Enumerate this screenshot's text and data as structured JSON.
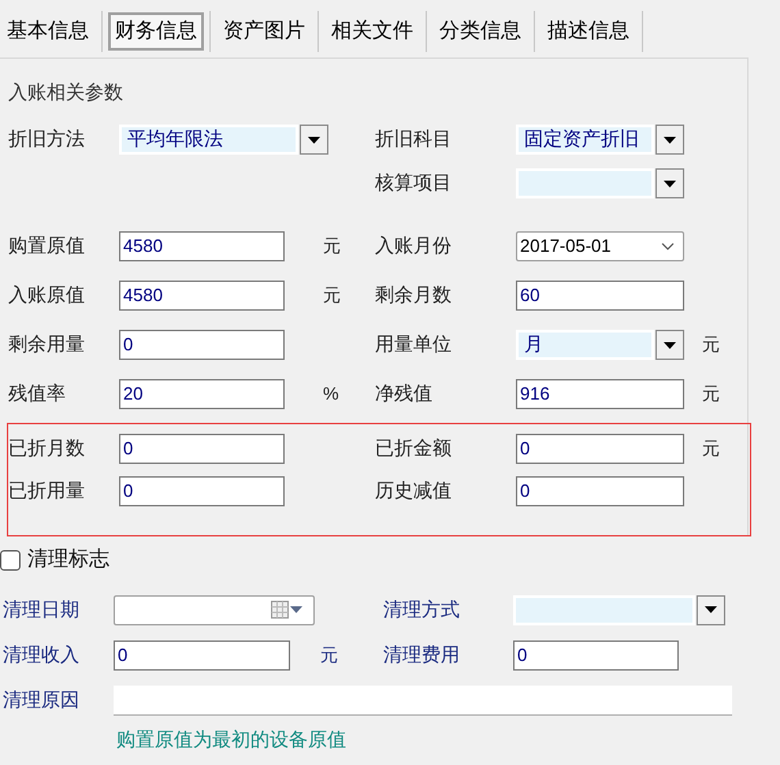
{
  "tabs": [
    {
      "label": "基本信息",
      "selected": false
    },
    {
      "label": "财务信息",
      "selected": true
    },
    {
      "label": "资产图片",
      "selected": false
    },
    {
      "label": "相关文件",
      "selected": false
    },
    {
      "label": "分类信息",
      "selected": false
    },
    {
      "label": "描述信息",
      "selected": false
    }
  ],
  "section_title": "入账相关参数",
  "account_rows": [
    {
      "left": {
        "label": "折旧方法",
        "field": {
          "kind": "combo",
          "value": "平均年限法"
        }
      },
      "right": {
        "label": "折旧科目",
        "field": {
          "kind": "combo",
          "value": "固定资产折旧"
        }
      }
    },
    {
      "right": {
        "label": "核算项目",
        "field": {
          "kind": "combo"
        }
      }
    }
  ],
  "value_rows": [
    {
      "left": {
        "label": "购置原值",
        "field": {
          "kind": "text",
          "value": "4580"
        },
        "unit": "元"
      },
      "right": {
        "label": "入账月份",
        "field": {
          "kind": "date",
          "value": "2017-05-01"
        }
      }
    },
    {
      "left": {
        "label": "入账原值",
        "field": {
          "kind": "text",
          "value": "4580"
        },
        "unit": "元"
      },
      "right": {
        "label": "剩余月数",
        "field": {
          "kind": "text",
          "value": "60"
        }
      }
    },
    {
      "left": {
        "label": "剩余用量",
        "field": {
          "kind": "text",
          "value": "0"
        }
      },
      "right": {
        "label": "用量单位",
        "field": {
          "kind": "combo",
          "value": "月"
        },
        "unit": "元"
      }
    },
    {
      "left": {
        "label": "残值率",
        "field": {
          "kind": "text",
          "value": "20"
        },
        "unit": "%"
      },
      "right": {
        "label": "净残值",
        "field": {
          "kind": "text",
          "value": "916"
        },
        "unit": "元"
      }
    }
  ],
  "highlighted_rows": [
    {
      "left": {
        "label": "已折月数",
        "field": {
          "kind": "text",
          "value": "0"
        }
      },
      "right": {
        "label": "已折金额",
        "field": {
          "kind": "text",
          "value": "0"
        },
        "unit": "元"
      }
    },
    {
      "left": {
        "label": "已折用量",
        "field": {
          "kind": "text",
          "value": "0"
        }
      },
      "right": {
        "label": "历史减值",
        "field": {
          "kind": "text",
          "value": "0"
        }
      }
    }
  ],
  "clear_flag": {
    "label": "清理标志",
    "checked": false
  },
  "disposal_rows": [
    {
      "left": {
        "label": "清理日期",
        "field": {
          "kind": "datepicker"
        }
      },
      "right": {
        "label": "清理方式",
        "field": {
          "kind": "combo"
        }
      }
    },
    {
      "left": {
        "label": "清理收入",
        "field": {
          "kind": "text",
          "value": "0"
        },
        "unit": "元"
      },
      "right": {
        "label": "清理费用",
        "field": {
          "kind": "text",
          "value": "0"
        }
      }
    },
    {
      "left": {
        "label": "清理原因",
        "field": {
          "kind": "long_text"
        }
      }
    }
  ],
  "note": "购置原值为最初的设备原值"
}
